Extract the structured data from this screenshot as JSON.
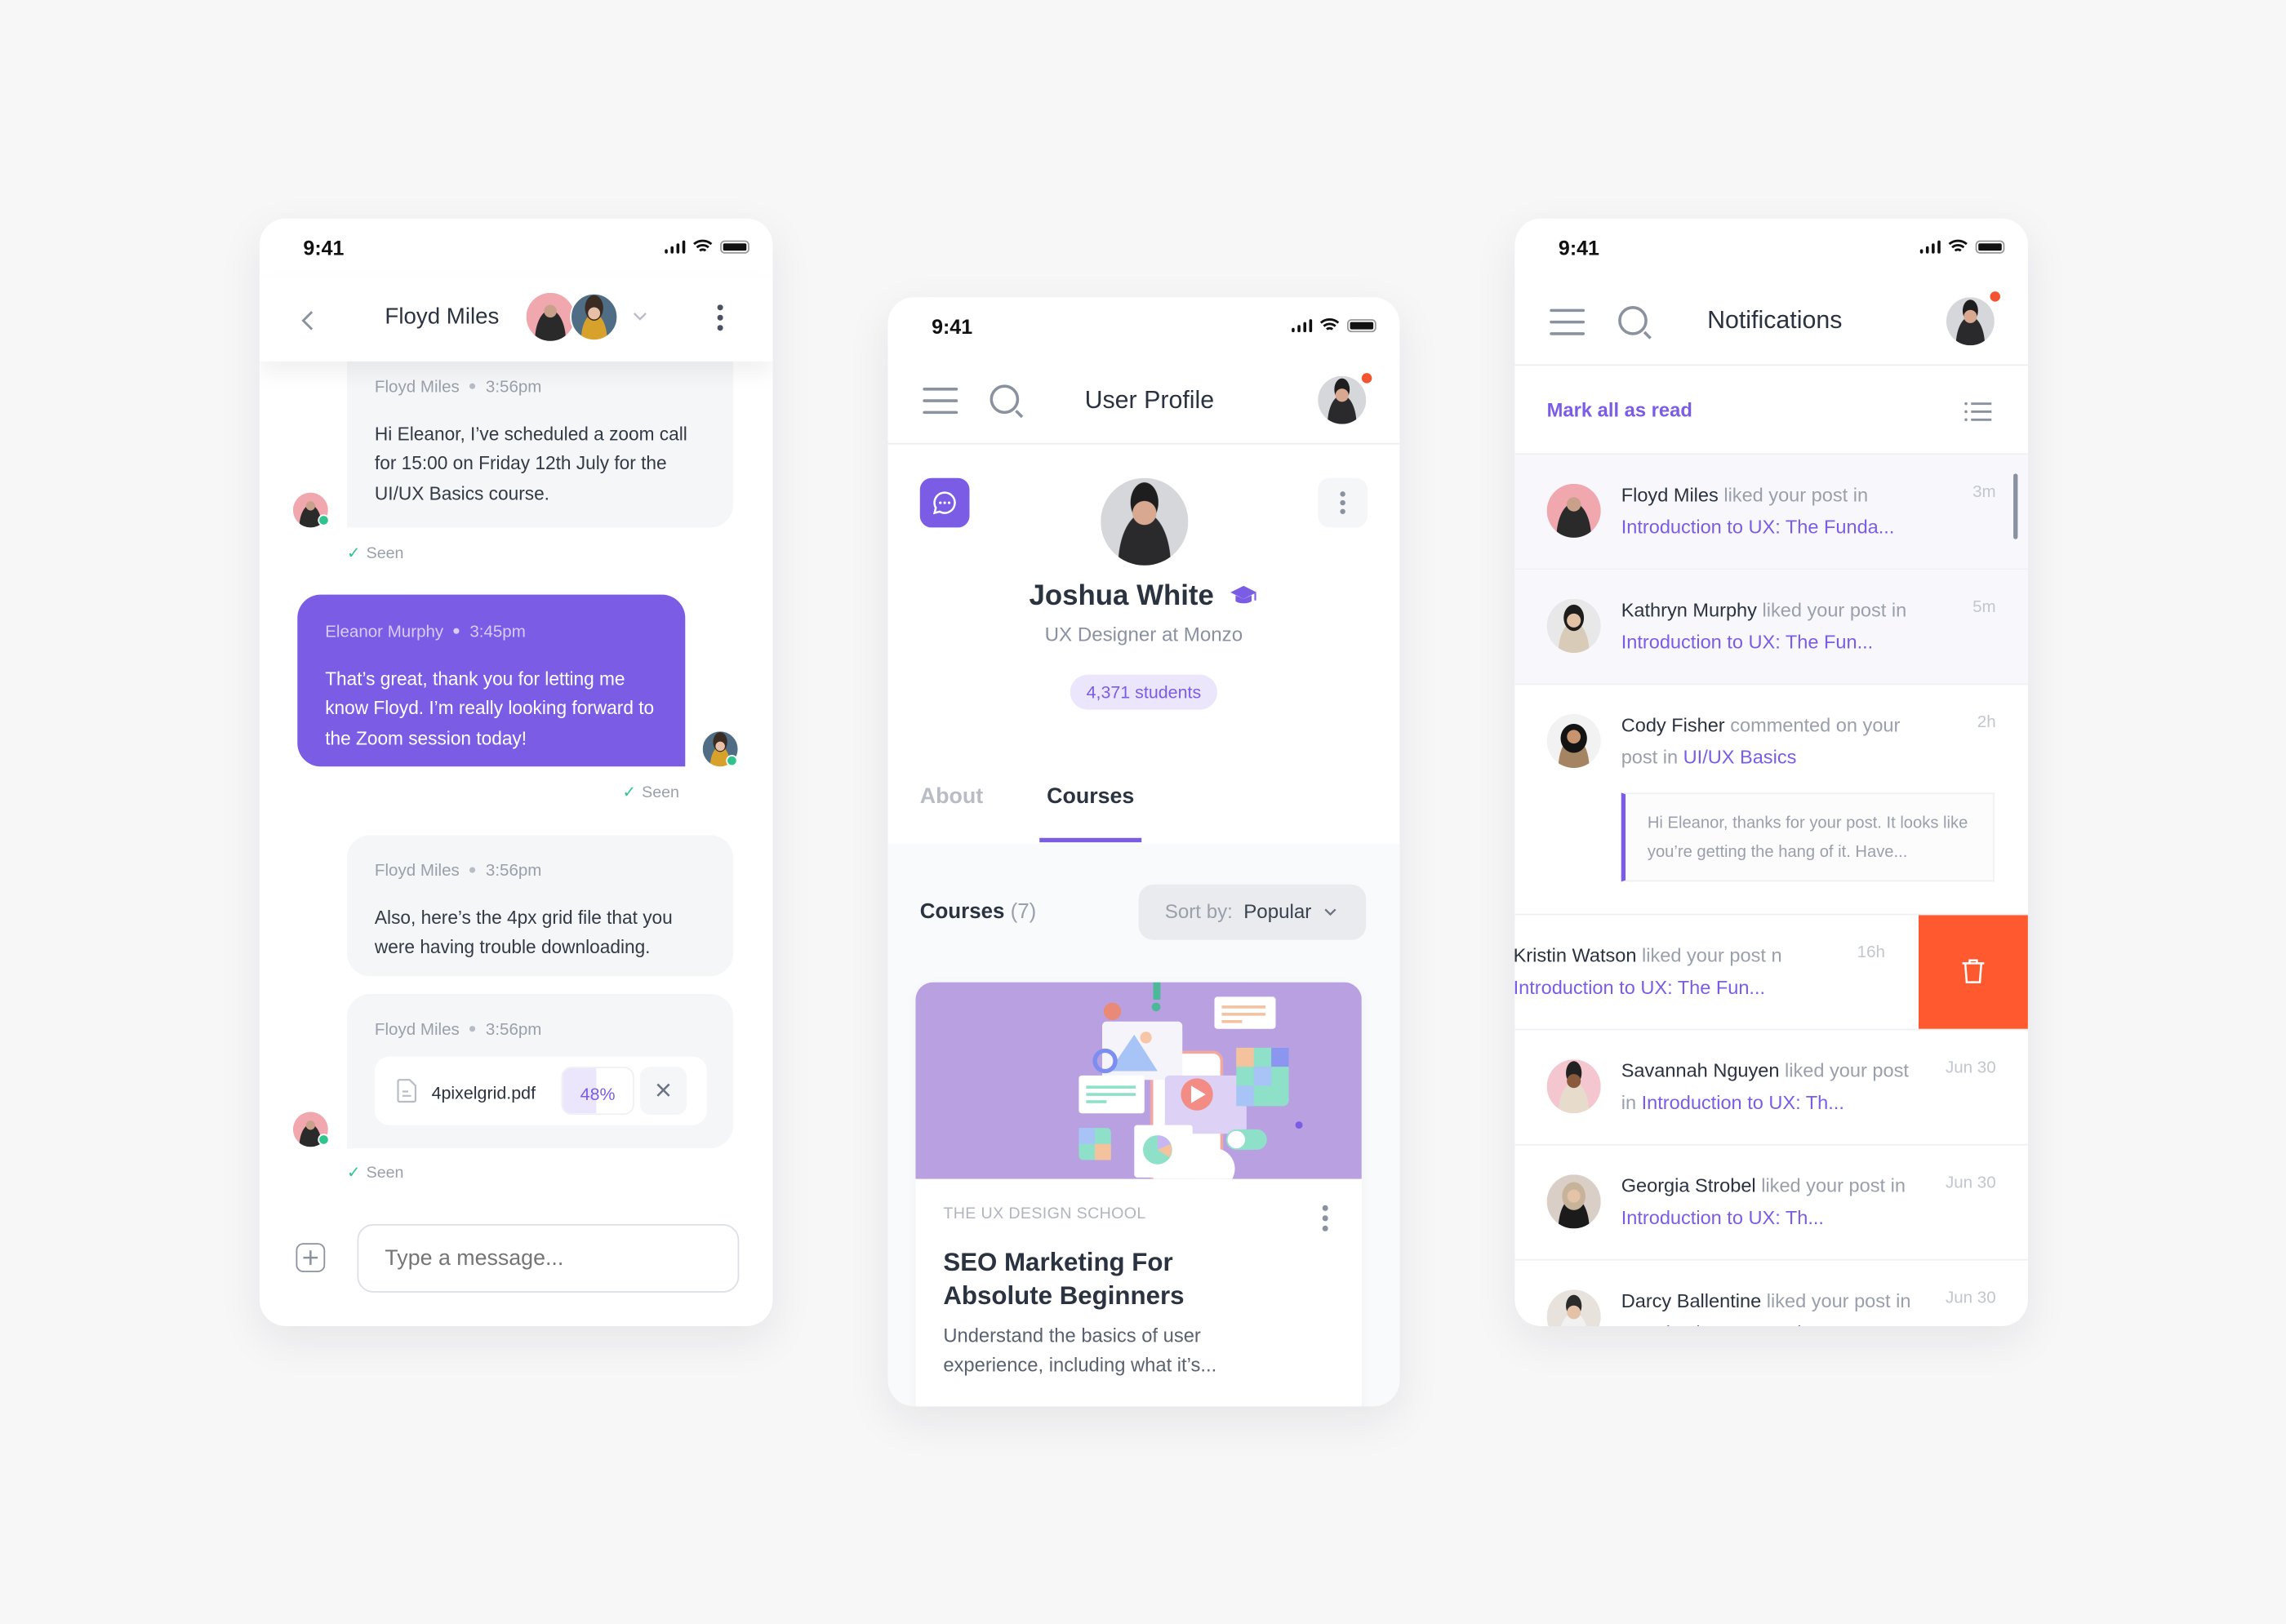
{
  "status_bar": {
    "time": "9:41"
  },
  "chat": {
    "header": {
      "title": "Floyd Miles",
      "participants": [
        "Floyd Miles",
        "Eleanor Murphy"
      ]
    },
    "messages": [
      {
        "sender": "Floyd Miles",
        "time": "3:56pm",
        "text": "Hi Eleanor, I’ve scheduled a zoom call for 15:00 on Friday 12th July for the UI/UX Basics course.",
        "status": "Seen",
        "direction": "in"
      },
      {
        "sender": "Eleanor Murphy",
        "time": "3:45pm",
        "text": "That’s great, thank you for letting me know Floyd. I’m really looking forward to the Zoom session today!",
        "status": "Seen",
        "direction": "out"
      },
      {
        "sender": "Floyd Miles",
        "time": "3:56pm",
        "text": "Also, here’s the 4px grid file that you were having trouble downloading.",
        "direction": "in"
      },
      {
        "sender": "Floyd Miles",
        "time": "3:56pm",
        "attachment": {
          "filename": "4pixelgrid.pdf",
          "progress_label": "48%",
          "progress": 0.48
        },
        "status": "Seen",
        "direction": "in"
      }
    ],
    "composer": {
      "placeholder": "Type a message..."
    },
    "colors": {
      "accent": "#7b5ce5",
      "online": "#2fc48d"
    }
  },
  "profile": {
    "header": {
      "title": "User Profile"
    },
    "user": {
      "name": "Joshua White",
      "title": "UX Designer at Monzo",
      "students": "4,371 students"
    },
    "tabs": [
      {
        "label": "About",
        "active": false
      },
      {
        "label": "Courses",
        "active": true
      }
    ],
    "courses": {
      "heading": "Courses",
      "count": "(7)",
      "sort_label": "Sort by:",
      "sort_value": "Popular"
    },
    "course_card": {
      "school": "THE UX DESIGN SCHOOL",
      "title_line1": "SEO Marketing For",
      "title_line2": "Absolute Beginners",
      "desc_line1": "Understand the basics of user",
      "desc_line2": "experience, including what it’s..."
    }
  },
  "notifications": {
    "header": {
      "title": "Notifications"
    },
    "mark_all": "Mark all as read",
    "items": [
      {
        "name": "Floyd Miles",
        "action": " liked your post in",
        "prefix": "",
        "link": "Introduction to UX: The Funda...",
        "time": "3m",
        "unread": true
      },
      {
        "name": "Kathryn Murphy",
        "action": " liked your post",
        "prefix": "in ",
        "link": "Introduction to UX: The Fun...",
        "time": "5m",
        "unread": true
      },
      {
        "name": "Cody Fisher",
        "action": " commented on",
        "prefix": "your post in ",
        "link": "UI/UX Basics",
        "time": "2h",
        "unread": false,
        "quote": "Hi Eleanor, thanks for your post. It looks like you’re getting the hang of it. Have..."
      },
      {
        "name": "Kristin Watson",
        "action": " liked your post",
        "prefix": "n ",
        "link": "Introduction to UX: The Fun...",
        "time": "16h",
        "unread": false,
        "swiped": true
      },
      {
        "name": "Savannah Nguyen",
        "action": " liked your",
        "prefix": "post in ",
        "link": "Introduction to UX: Th...",
        "time": "Jun 30",
        "unread": false
      },
      {
        "name": "Georgia Strobel",
        "action": " liked your post",
        "prefix": "in ",
        "link": "Introduction to UX: Th...",
        "time": "Jun 30",
        "unread": false
      },
      {
        "name": "Darcy Ballentine",
        "action": " liked your post",
        "prefix": "in ",
        "link": "Introduction to UX: Th...",
        "time": "Jun 30",
        "unread": false
      }
    ],
    "colors": {
      "delete": "#ff5a2f",
      "unread_bg": "#f8f8fc"
    }
  }
}
